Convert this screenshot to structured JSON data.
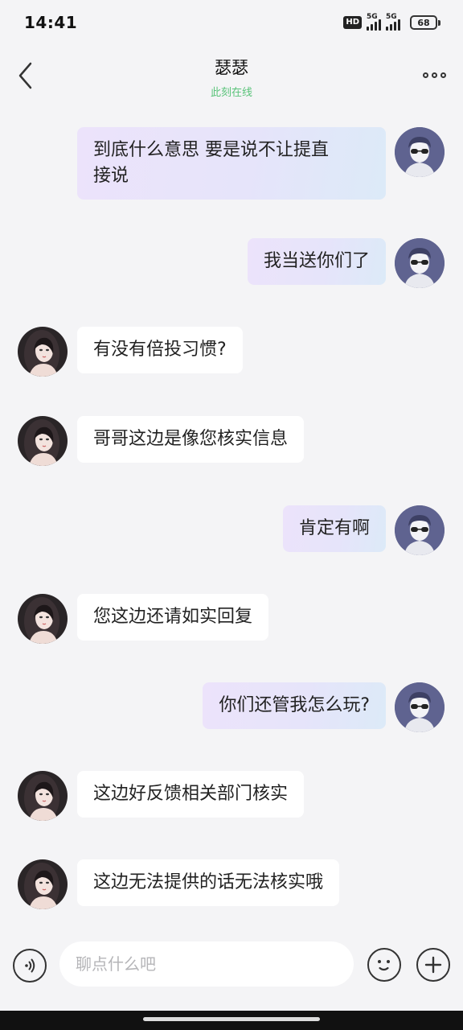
{
  "status_bar": {
    "time": "14:41",
    "hd_label": "HD",
    "network_1": "5G",
    "network_2": "5G",
    "battery": "68"
  },
  "header": {
    "title": "瑟瑟",
    "subtitle": "此刻在线",
    "back_icon": "chevron-left-icon",
    "more_icon": "more-dots-icon",
    "online_color": "#5ac37a"
  },
  "messages": [
    {
      "sender": "me",
      "text": "到底什么意思 要是说不让提直\n接说"
    },
    {
      "sender": "me",
      "text": "我当送你们了"
    },
    {
      "sender": "them",
      "text": "有没有倍投习惯?"
    },
    {
      "sender": "them",
      "text": "哥哥这边是像您核实信息"
    },
    {
      "sender": "me",
      "text": "肯定有啊"
    },
    {
      "sender": "them",
      "text": "您这边还请如实回复"
    },
    {
      "sender": "me",
      "text": "你们还管我怎么玩?"
    },
    {
      "sender": "them",
      "text": "这边好反馈相关部门核实"
    },
    {
      "sender": "them",
      "text": "这边无法提供的话无法核实哦"
    }
  ],
  "input": {
    "placeholder": "聊点什么吧",
    "voice_icon": "voice-icon",
    "emoji_icon": "emoji-icon",
    "add_icon": "plus-icon"
  },
  "colors": {
    "background": "#f4f4f6",
    "my_bubble_start": "#ece3fb",
    "my_bubble_end": "#dceaf8",
    "their_bubble": "#ffffff"
  }
}
